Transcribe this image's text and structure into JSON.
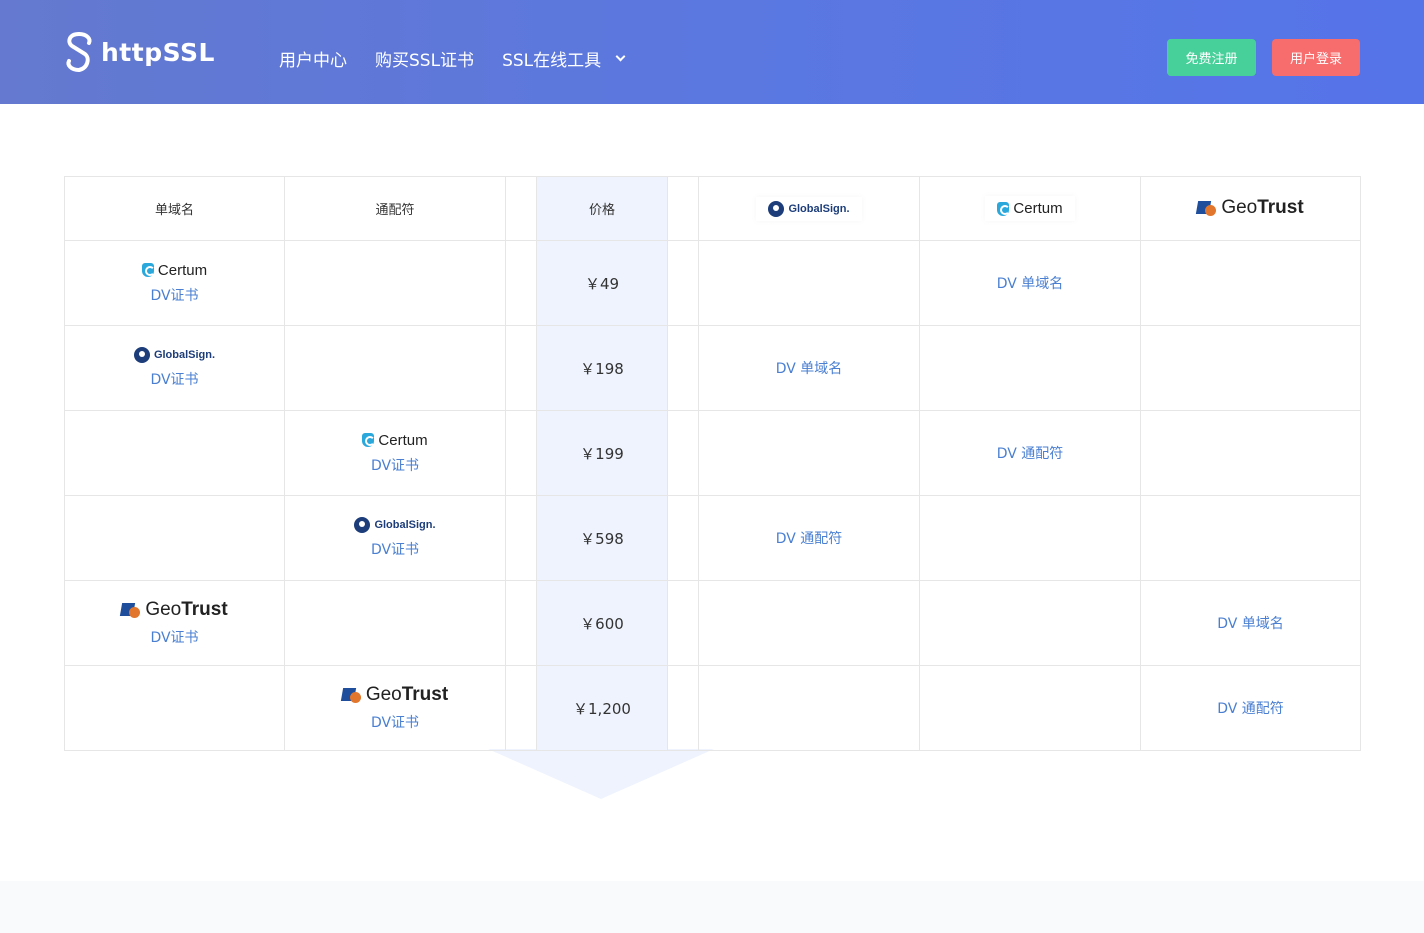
{
  "header": {
    "logo_text": "httpSSL",
    "nav": [
      {
        "label": "用户中心"
      },
      {
        "label": "购买SSL证书"
      },
      {
        "label": "SSL在线工具"
      }
    ],
    "register_label": "免费注册",
    "login_label": "用户登录"
  },
  "table": {
    "headers": {
      "single_domain": "单域名",
      "wildcard": "通配符",
      "price": "价格"
    },
    "brands": {
      "globalsign": "GlobalSign.",
      "certum": "Certum",
      "geotrust_a": "Geo",
      "geotrust_b": "Trust"
    },
    "rows": [
      {
        "product_label": "DV证书",
        "price": "￥49",
        "link": "DV 单域名"
      },
      {
        "product_label": "DV证书",
        "price": "￥198",
        "link": "DV 单域名"
      },
      {
        "product_label": "DV证书",
        "price": "￥199",
        "link": "DV 通配符"
      },
      {
        "product_label": "DV证书",
        "price": "￥598",
        "link": "DV 通配符"
      },
      {
        "product_label": "DV证书",
        "price": "￥600",
        "link": "DV 单域名"
      },
      {
        "product_label": "DV证书",
        "price": "￥1,200",
        "link": "DV 通配符"
      }
    ]
  },
  "colors": {
    "header_gradient_start": "#6479cf",
    "header_gradient_end": "#5574e8",
    "register_button": "#47d09a",
    "login_button": "#f76c6c",
    "link": "#4a7fd1",
    "price_band": "#eef3fd"
  }
}
